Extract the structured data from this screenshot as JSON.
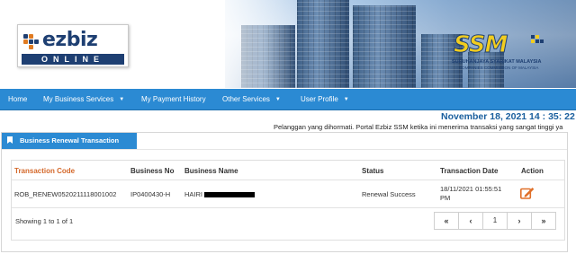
{
  "header": {
    "logo_word": "ezbiz",
    "logo_sub": "ONLINE",
    "ssm_letters": "SSM",
    "ssm_line1": "SURUHANJAYA SYARIKAT MALAYSIA",
    "ssm_line2": "COMPANIES COMMISSION OF MALAYSIA"
  },
  "nav": {
    "home": "Home",
    "business_services": "My Business Services",
    "payment_history": "My Payment History",
    "other_services": "Other Services",
    "user_profile": "User Profile"
  },
  "datetime": "November 18, 2021 14 : 35: 22",
  "marquee": "Pelanggan yang dihormati. Portal Ezbiz SSM ketika ini menerima transaksi yang sangat tinggi ya",
  "panel": {
    "title": "Business Renewal Transaction"
  },
  "table": {
    "headers": {
      "code": "Transaction Code",
      "business_no": "Business No",
      "business_name": "Business Name",
      "status": "Status",
      "date": "Transaction Date",
      "action": "Action"
    },
    "rows": [
      {
        "code": "ROB_RENEW0520211118001002",
        "business_no": "IP0400430-H",
        "business_name": "HAIRI",
        "status": "Renewal Success",
        "date_line1": "18/11/2021 01:55:51",
        "date_line2": "PM",
        "action_icon": "edit-icon"
      }
    ],
    "showing": "Showing 1 to 1 of 1",
    "pager": {
      "first": "«",
      "prev": "‹",
      "current": "1",
      "next": "›",
      "last": "»"
    }
  },
  "colors": {
    "nav_blue": "#2b8ad3",
    "accent_orange": "#d4682a",
    "date_blue": "#1a5f9e"
  }
}
